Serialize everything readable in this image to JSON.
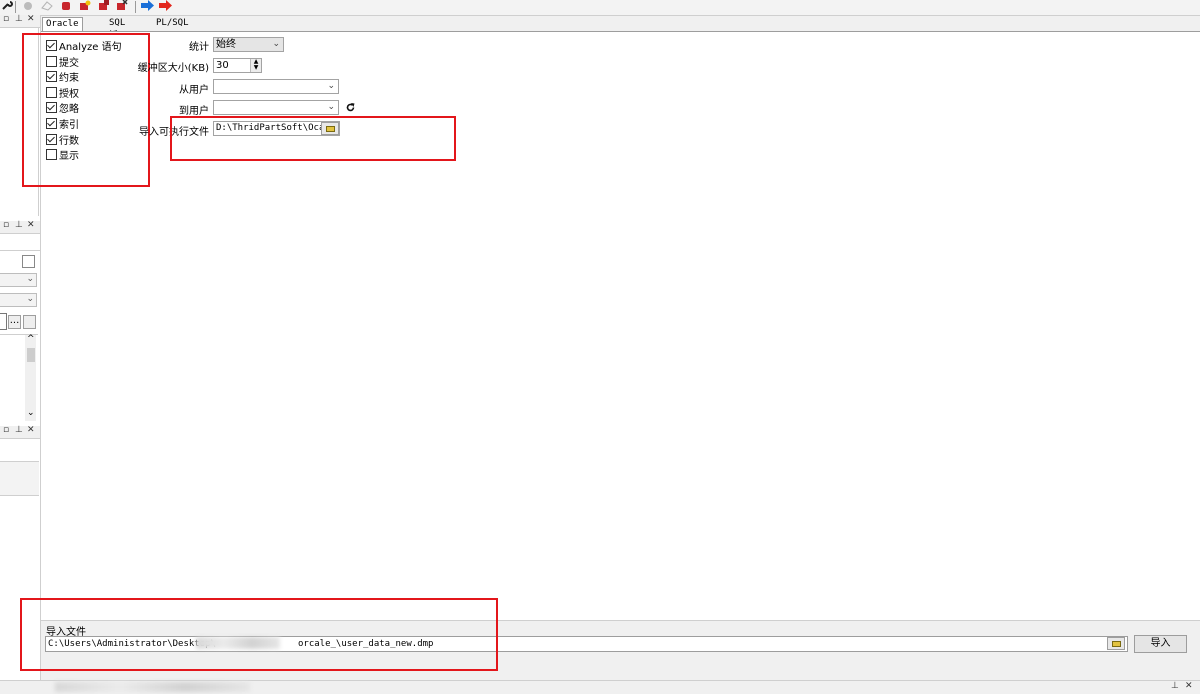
{
  "toolbar": {
    "icons": [
      "wrench-icon",
      "refresh-icon",
      "eraser-icon",
      "red-shape-icon",
      "star-shape-icon",
      "copy-shape-icon",
      "delete-shape-icon",
      "arrow-right-blue-icon",
      "arrow-right-red-icon"
    ]
  },
  "tabs": [
    {
      "label": "Oracle 导入",
      "active": true
    },
    {
      "label": "SQL 插入",
      "active": false
    },
    {
      "label": "PL/SQL Developer",
      "active": false
    }
  ],
  "options": [
    {
      "label": "Analyze 语句",
      "checked": true
    },
    {
      "label": "提交",
      "checked": false
    },
    {
      "label": "约束",
      "checked": true
    },
    {
      "label": "授权",
      "checked": false
    },
    {
      "label": "忽略",
      "checked": true
    },
    {
      "label": "索引",
      "checked": true
    },
    {
      "label": "行数",
      "checked": true
    },
    {
      "label": "显示",
      "checked": false
    }
  ],
  "form": {
    "stats_label": "统计",
    "stats_value": "始终",
    "buffer_label": "缓冲区大小(KB)",
    "buffer_value": "30",
    "from_user_label": "从用户",
    "from_user_value": "",
    "to_user_label": "到用户",
    "to_user_value": "",
    "exe_label": "导入可执行文件",
    "exe_value": "D:\\ThridPartSoft\\Ocac"
  },
  "bottom": {
    "import_file_label": "导入文件",
    "import_file_prefix": "C:\\Users\\Administrator\\Desktop\\",
    "import_file_suffix": "orcale_\\user_data_new.dmp",
    "import_button": "导入"
  },
  "left_panel": {
    "browse_button": "..."
  },
  "colors": {
    "highlight": "#e3161b",
    "background": "#f0f0f0",
    "panel": "#ffffff"
  }
}
